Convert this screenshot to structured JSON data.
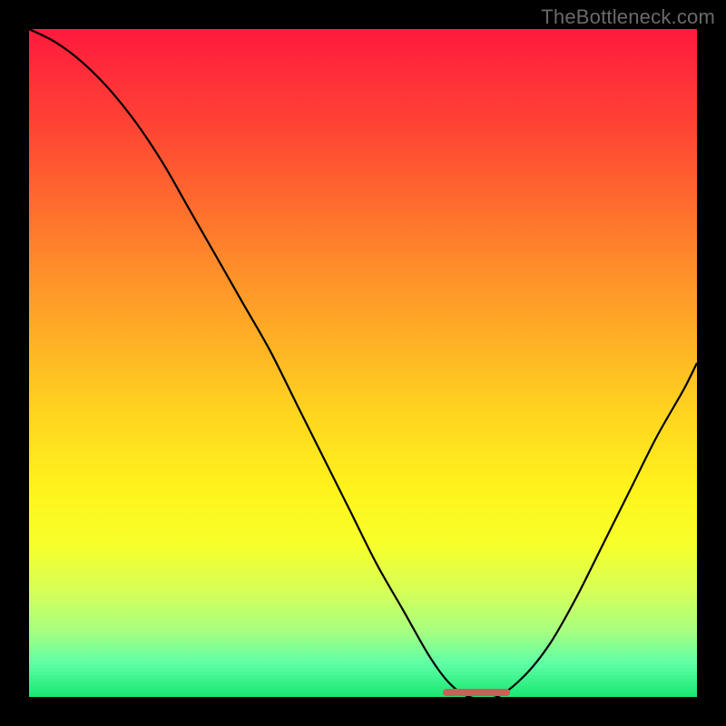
{
  "watermark": "TheBottleneck.com",
  "colors": {
    "frame_bg": "#000000",
    "curve": "#000000",
    "marker": "#c86057",
    "watermark": "#6a6a6a",
    "gradient_top": "#ff1a3c",
    "gradient_bottom": "#17e86f"
  },
  "chart_data": {
    "type": "line",
    "title": "",
    "xlabel": "",
    "ylabel": "",
    "xlim": [
      0,
      100
    ],
    "ylim": [
      0,
      100
    ],
    "grid": false,
    "legend": false,
    "series": [
      {
        "name": "bottleneck-curve",
        "x": [
          0,
          4,
          8,
          12,
          16,
          20,
          24,
          28,
          32,
          36,
          40,
          44,
          48,
          52,
          56,
          60,
          63,
          66,
          70,
          74,
          78,
          82,
          86,
          90,
          94,
          98,
          100
        ],
        "values": [
          100,
          98,
          95,
          91,
          86,
          80,
          73,
          66,
          59,
          52,
          44,
          36,
          28,
          20,
          13,
          6,
          2,
          0,
          0,
          3,
          8,
          15,
          23,
          31,
          39,
          46,
          50
        ]
      }
    ],
    "markers": [
      {
        "name": "optimal-range",
        "x_start": 62,
        "x_end": 72,
        "y": 0
      }
    ],
    "annotations": []
  }
}
